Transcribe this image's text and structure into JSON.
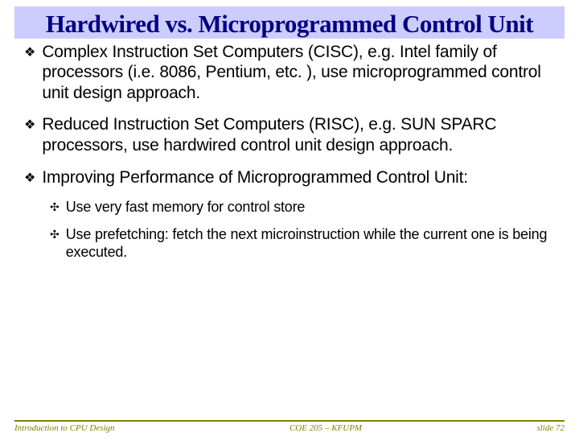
{
  "title": "Hardwired vs. Microprogrammed Control Unit",
  "bullets": [
    {
      "text": "Complex Instruction Set Computers (CISC), e.g. Intel family of processors (i.e. 8086, Pentium, etc. ), use microprogrammed control unit design approach."
    },
    {
      "text": "Reduced Instruction Set Computers (RISC), e.g. SUN SPARC processors, use hardwired control unit design approach."
    },
    {
      "text": "Improving Performance of Microprogrammed Control Unit:"
    }
  ],
  "subbullets": [
    {
      "text": "Use very fast memory for control store"
    },
    {
      "text": "Use prefetching: fetch the next microinstruction while the current one is being executed."
    }
  ],
  "footer": {
    "left": "Introduction to CPU Design",
    "center": "COE 205 – KFUPM",
    "right": "slide 72"
  },
  "glyphs": {
    "diamond": "❖",
    "maltese": "✣"
  }
}
